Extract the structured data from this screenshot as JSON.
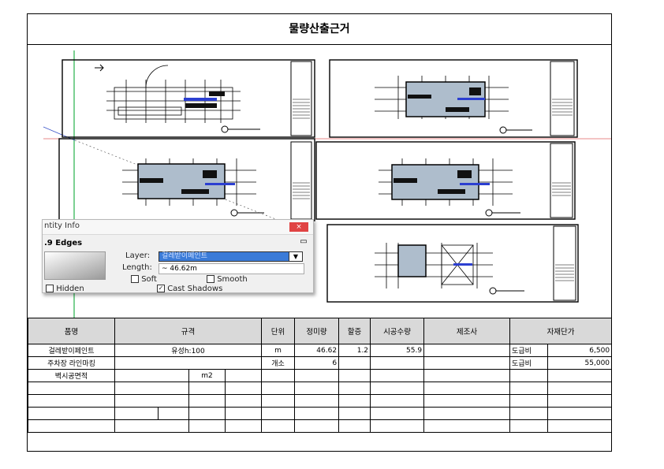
{
  "title": "물량산출근거",
  "entity_info": {
    "window_title": "ntity Info",
    "edges": ".9 Edges",
    "close": "×",
    "layer_label": "Layer:",
    "layer_value": "걸레받이페인트",
    "length_label": "Length:",
    "length_value": "~ 46.62m",
    "soft": "Soft",
    "smooth": "Smooth",
    "hidden": "Hidden",
    "cast_shadows": "Cast Shadows"
  },
  "table": {
    "headers": {
      "item": "품명",
      "spec": "규격",
      "unit": "단위",
      "net_qty": "정미량",
      "surcharge": "할증",
      "work_qty": "시공수량",
      "maker": "제조사",
      "unit_price": "자재단가"
    },
    "rows": [
      {
        "item": "걸레받이페인트",
        "spec": "유성h:100",
        "unit": "m",
        "net_qty": "46.62",
        "surcharge": "1.2",
        "work_qty": "55.9",
        "price_type": "도급비",
        "price": "6,500"
      },
      {
        "item": "주차장 라인마킹",
        "spec": "",
        "unit": "개소",
        "net_qty": "6",
        "surcharge": "",
        "work_qty": "",
        "price_type": "도급비",
        "price": "55,000"
      },
      {
        "item": "벽시공면적",
        "spec_unit": "m2"
      }
    ]
  }
}
